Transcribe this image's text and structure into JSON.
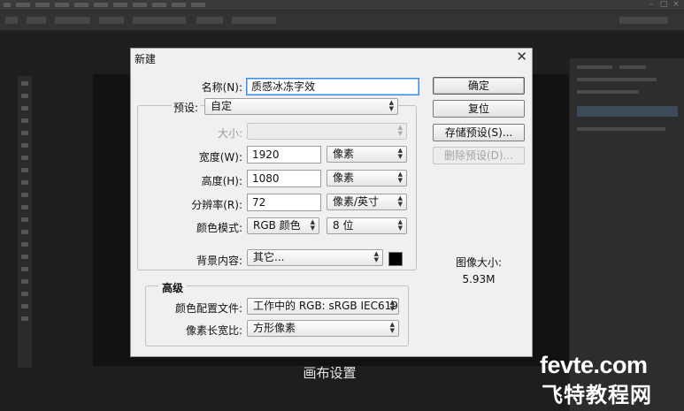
{
  "dialog": {
    "title": "新建",
    "close_glyph": "✕",
    "name": {
      "label": "名称(N):",
      "value": "质感冰冻字效"
    },
    "preset": {
      "label": "预设:",
      "value": "自定"
    },
    "size": {
      "label": "大小:",
      "value": ""
    },
    "width": {
      "label": "宽度(W):",
      "value": "1920",
      "unit": "像素"
    },
    "height": {
      "label": "高度(H):",
      "value": "1080",
      "unit": "像素"
    },
    "resolution": {
      "label": "分辨率(R):",
      "value": "72",
      "unit": "像素/英寸"
    },
    "color_mode": {
      "label": "颜色模式:",
      "mode": "RGB 颜色",
      "depth": "8 位"
    },
    "background": {
      "label": "背景内容:",
      "value": "其它...",
      "swatch_color": "#000000"
    },
    "advanced": {
      "title": "高级",
      "color_profile": {
        "label": "颜色配置文件:",
        "value": "工作中的 RGB: sRGB IEC619..."
      },
      "pixel_aspect": {
        "label": "像素长宽比:",
        "value": "方形像素"
      }
    },
    "buttons": {
      "ok": "确定",
      "reset": "复位",
      "save_preset": "存储预设(S)...",
      "delete_preset": "删除预设(D)..."
    },
    "image_size": {
      "label": "图像大小:",
      "value": "5.93M"
    }
  },
  "caption": "画布设置",
  "watermark": {
    "line1": "fevte.com",
    "line2": "飞特教程网"
  },
  "colors": {
    "dialog_bg": "#f0f0f0",
    "focus_border": "#3d8ee6",
    "app_bg": "#1e1e1e"
  }
}
